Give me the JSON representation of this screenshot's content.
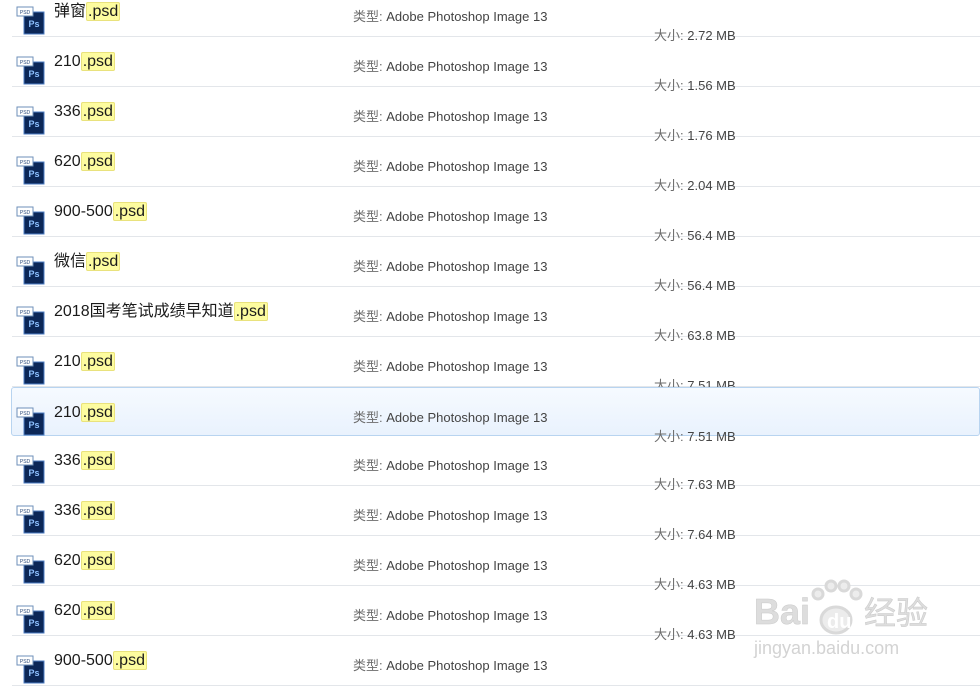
{
  "labels": {
    "type_label": "类型:",
    "size_label": "大小:"
  },
  "files": [
    {
      "name": "弹窗",
      "ext": ".psd",
      "type": "Adobe Photoshop Image 13",
      "size": "2.72 MB",
      "icon": "photoshop-psd-icon"
    },
    {
      "name": "210",
      "ext": ".psd",
      "type": "Adobe Photoshop Image 13",
      "size": "1.56 MB",
      "icon": "photoshop-psd-icon"
    },
    {
      "name": "336",
      "ext": ".psd",
      "type": "Adobe Photoshop Image 13",
      "size": "1.76 MB",
      "icon": "photoshop-psd-icon"
    },
    {
      "name": "620",
      "ext": ".psd",
      "type": "Adobe Photoshop Image 13",
      "size": "2.04 MB",
      "icon": "photoshop-psd-icon"
    },
    {
      "name": "900-500",
      "ext": ".psd",
      "type": "Adobe Photoshop Image 13",
      "size": "56.4 MB",
      "icon": "photoshop-psd-icon"
    },
    {
      "name": "微信",
      "ext": ".psd",
      "type": "Adobe Photoshop Image 13",
      "size": "56.4 MB",
      "icon": "photoshop-psd-icon"
    },
    {
      "name": "2018国考笔试成绩早知道",
      "ext": ".psd",
      "type": "Adobe Photoshop Image 13",
      "size": "63.8 MB",
      "icon": "photoshop-psd-icon"
    },
    {
      "name": "210",
      "ext": ".psd",
      "type": "Adobe Photoshop Image 13",
      "size": "7.51 MB",
      "icon": "photoshop-psd-icon"
    },
    {
      "name": "210",
      "ext": ".psd",
      "type": "Adobe Photoshop Image 13",
      "size": "7.51 MB",
      "icon": "photoshop-psd-icon",
      "selected": true
    },
    {
      "name": "336",
      "ext": ".psd",
      "type": "Adobe Photoshop Image 13",
      "size": "7.63 MB",
      "icon": "photoshop-psd-icon"
    },
    {
      "name": "336",
      "ext": ".psd",
      "type": "Adobe Photoshop Image 13",
      "size": "7.64 MB",
      "icon": "photoshop-psd-icon"
    },
    {
      "name": "620",
      "ext": ".psd",
      "type": "Adobe Photoshop Image 13",
      "size": "4.63 MB",
      "icon": "photoshop-psd-icon"
    },
    {
      "name": "620",
      "ext": ".psd",
      "type": "Adobe Photoshop Image 13",
      "size": "4.63 MB",
      "icon": "photoshop-psd-icon"
    },
    {
      "name": "900-500",
      "ext": ".psd",
      "type": "Adobe Photoshop Image 13",
      "size": "",
      "icon": "photoshop-psd-icon"
    }
  ],
  "watermark": {
    "brand": "Bai",
    "brand2": "du",
    "cn": "经验",
    "url": "jingyan.baidu.com"
  },
  "colors": {
    "highlight": "#fdfc9f",
    "selected_bg": "#e9f2fd",
    "ps_blue": "#0d2a5c"
  }
}
